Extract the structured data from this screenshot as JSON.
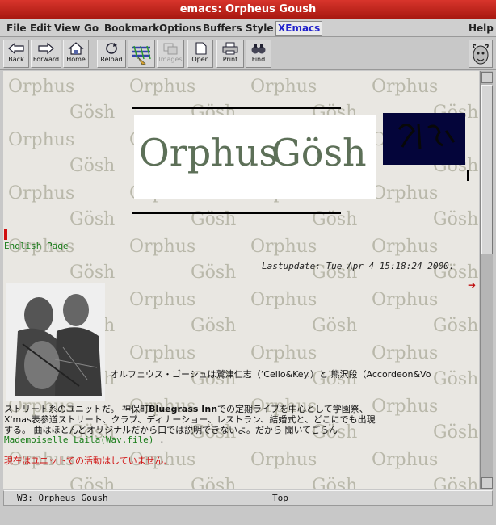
{
  "window": {
    "title": "emacs: Orpheus Goush"
  },
  "menubar": {
    "items": [
      "File",
      "Edit",
      "View",
      "Go",
      "Bookmark",
      "Options",
      "Buffers",
      "Style",
      "XEmacs"
    ],
    "help": "Help"
  },
  "toolbar": {
    "back": "Back",
    "forward": "Forward",
    "home": "Home",
    "reload": "Reload",
    "images": "Images",
    "open": "Open",
    "print": "Print",
    "find": "Find"
  },
  "page": {
    "logo_word1": "Orphus",
    "logo_word2": "Gösh",
    "english_link": "English Page",
    "lastupdate": "Lastupdate: Tue Apr 4 15:18:24 2000.",
    "intro_line1": "オルフェウス・ゴーシュは鷲津仁志（’Cello&Key.）と 熊沢段（Accordeon&Vo",
    "intro_line2_a": "ストリート系のユニットだ。 神保町",
    "intro_line2_bold": "Bluegrass Inn",
    "intro_line2_b": "での定期ライブを中心として学園祭、",
    "intro_line3": "X'mas表参道ストリート、クラブ、ディナーショー、レストラン、結婚式と、どこにでも出現",
    "intro_line4": "する。 曲はほとんどオリジナルだから口では説明できないよ。だから 聞いてごらん",
    "laila_link": "Mademoiselle Laila(Wav.file)",
    "laila_suffix": ".",
    "notice": "現在はユニットでの活動はしていません."
  },
  "modeline": {
    "buffer": "W3: Orpheus Goush",
    "position": "Top"
  }
}
